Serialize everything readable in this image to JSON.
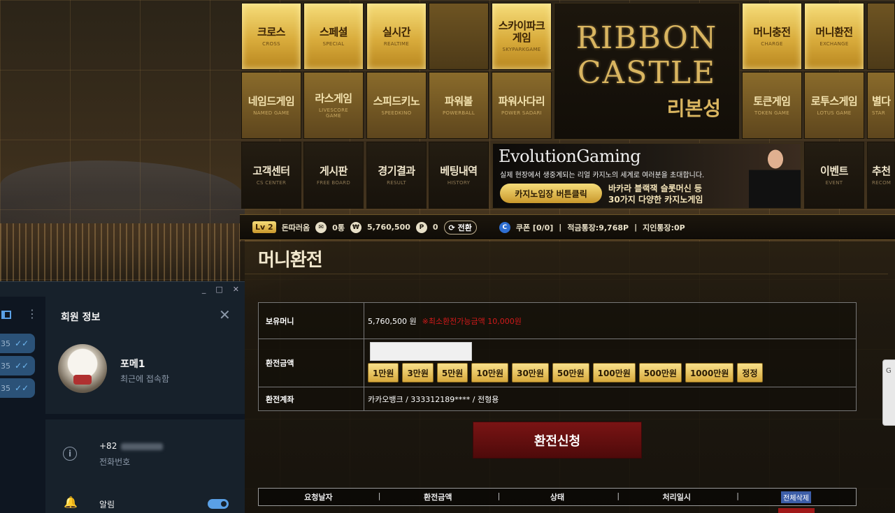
{
  "nav": {
    "row1": [
      {
        "ko": "크로스",
        "en": "CROSS"
      },
      {
        "ko": "스페셜",
        "en": "SPECIAL"
      },
      {
        "ko": "실시간",
        "en": "REALTIME"
      },
      {
        "ko": "스카이파크게임",
        "en": "SKYPARKGAME"
      },
      {
        "ko": "머니충전",
        "en": "CHARGE"
      },
      {
        "ko": "머니환전",
        "en": "EXCHANGE"
      }
    ],
    "row2": [
      {
        "ko": "네임드게임",
        "en": "NAMED GAME"
      },
      {
        "ko": "라스게임",
        "en": "LIVESCORE GAME"
      },
      {
        "ko": "스피드키노",
        "en": "SPEEDKINO"
      },
      {
        "ko": "파워볼",
        "en": "POWERBALL"
      },
      {
        "ko": "파워사다리",
        "en": "POWER SADARI"
      },
      {
        "ko": "토큰게임",
        "en": "TOKEN GAME"
      },
      {
        "ko": "로투스게임",
        "en": "LOTUS GAME"
      },
      {
        "ko": "별다",
        "en": "STAR"
      }
    ],
    "row3": [
      {
        "ko": "고객센터",
        "en": "CS CENTER"
      },
      {
        "ko": "게시판",
        "en": "FREE BOARD"
      },
      {
        "ko": "경기결과",
        "en": "RESULT"
      },
      {
        "ko": "베팅내역",
        "en": "HISTORY"
      },
      {
        "ko": "이벤트",
        "en": "EVENT"
      },
      {
        "ko": "추천",
        "en": "RECOM"
      }
    ]
  },
  "logo": {
    "line1": "RIBBON",
    "line2": "CASTLE",
    "line3": "리본성"
  },
  "banner": {
    "title": "EvolutionGaming",
    "subtitle": "실제 현장에서 생중계되는 리얼 카지노의 세계로 여러분을 초대합니다.",
    "button": "카지노입장 버튼클릭",
    "desc1": "바카라 블랙잭 슬롯머신 등",
    "desc2": "30가지 다양한 카지노게임"
  },
  "status": {
    "level_prefix": "Lv",
    "level": "2",
    "username": "돈따러옴",
    "messages": "0통",
    "money": "5,760,500",
    "points": "0",
    "convert": "전환",
    "coupon": "쿠폰 [0/0]",
    "accum": "적금통장:9,768P",
    "friend": "지인통장:0P"
  },
  "page": {
    "title": "머니환전"
  },
  "form": {
    "balance_label": "보유머니",
    "balance_value": "5,760,500 원",
    "balance_warn": "※최소환전가능금액 10,000원",
    "amount_label": "환전금액",
    "amount_value": "",
    "amounts": [
      "1만원",
      "3만원",
      "5만원",
      "10만원",
      "30만원",
      "50만원",
      "100만원",
      "500만원",
      "1000만원",
      "정정"
    ],
    "account_label": "환전계좌",
    "account_value": "카카오뱅크 / 333312189**** / 전형용"
  },
  "submit_label": "환전신청",
  "history": {
    "headers": [
      "요청날자",
      "환전금액",
      "상태",
      "처리일시"
    ],
    "delete_all": "전체삭제"
  },
  "messenger": {
    "window_controls": [
      "_",
      "□",
      "✕"
    ],
    "bubble_times": [
      "35",
      "35",
      "35"
    ],
    "panel_title": "회원 정보",
    "name": "포메1",
    "status": "최근에 접속함",
    "phone_prefix": "+82",
    "phone_label": "전화번호",
    "notifications_label": "알림",
    "notifications_on": true
  }
}
